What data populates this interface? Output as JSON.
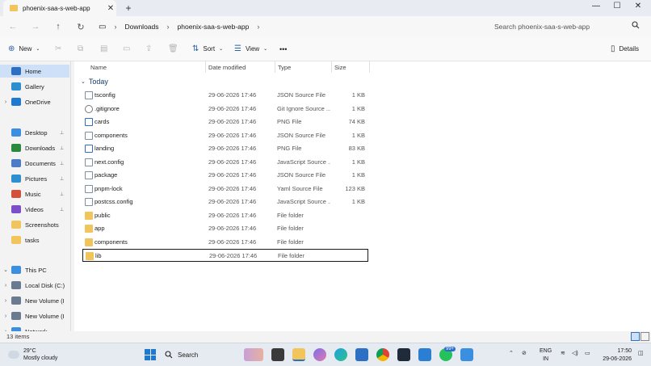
{
  "window": {
    "tab_title": "phoenix-saa-s-web-app",
    "tab_close": "✕",
    "new_tab": "+",
    "minimize": "—",
    "maximize": "☐",
    "close": "✕"
  },
  "address": {
    "back": "←",
    "forward": "→",
    "up": "↑",
    "refresh": "↻",
    "monitor_icon": "▭",
    "crumbs": [
      "Downloads",
      "phoenix-saa-s-web-app"
    ],
    "separator": "›",
    "search_placeholder": "Search phoenix-saa-s-web-app"
  },
  "toolbar": {
    "new_label": "New",
    "sort_label": "Sort",
    "view_label": "View",
    "more_label": "•••",
    "details_label": "Details"
  },
  "sidebar": {
    "items": [
      {
        "label": "Home",
        "selected": true,
        "icon": "home-icon",
        "color": "#2d6fc2"
      },
      {
        "label": "Gallery",
        "icon": "gallery-icon",
        "color": "#2d8fd0"
      },
      {
        "label": "OneDrive",
        "icon": "cloud-icon",
        "color": "#1f79d1",
        "chevron": "›"
      },
      {
        "label": "Desktop",
        "icon": "desktop-icon",
        "color": "#3a8fe0",
        "pin": "📌"
      },
      {
        "label": "Downloads",
        "icon": "download-icon",
        "color": "#2b8a3e",
        "pin": "📌"
      },
      {
        "label": "Documents",
        "icon": "document-icon",
        "color": "#4a7cc9",
        "pin": "📌"
      },
      {
        "label": "Pictures",
        "icon": "pictures-icon",
        "color": "#2d8fd0",
        "pin": "📌"
      },
      {
        "label": "Music",
        "icon": "music-icon",
        "color": "#d4503a",
        "pin": "📌"
      },
      {
        "label": "Videos",
        "icon": "videos-icon",
        "color": "#7a4fc9",
        "pin": "📌"
      },
      {
        "label": "Screenshots",
        "icon": "folder-icon",
        "color": "#f2c55c"
      },
      {
        "label": "tasks",
        "icon": "folder-icon",
        "color": "#f2c55c"
      },
      {
        "label": "This PC",
        "icon": "pc-icon",
        "color": "#3a8fe0",
        "chevron": "⌄"
      },
      {
        "label": "Local Disk (C:)",
        "icon": "drive-icon",
        "color": "#6a7a90",
        "chevron": "›"
      },
      {
        "label": "New Volume (I",
        "icon": "drive-icon",
        "color": "#6a7a90",
        "chevron": "›"
      },
      {
        "label": "New Volume (I",
        "icon": "drive-icon",
        "color": "#6a7a90",
        "chevron": "›"
      },
      {
        "label": "Network",
        "icon": "network-icon",
        "color": "#3a8fe0",
        "chevron": "›"
      }
    ]
  },
  "columns": {
    "name": "Name",
    "date": "Date modified",
    "type": "Type",
    "size": "Size"
  },
  "group_label": "Today",
  "files": [
    {
      "name": "tsconfig",
      "date": "29-06-2026 17:46",
      "type": "JSON Source File",
      "size": "1 KB",
      "kind": "file"
    },
    {
      "name": ".gitignore",
      "date": "29-06-2026 17:46",
      "type": "Git Ignore Source ...",
      "size": "1 KB",
      "kind": "gear"
    },
    {
      "name": "cards",
      "date": "29-06-2026 17:46",
      "type": "PNG File",
      "size": "74 KB",
      "kind": "img"
    },
    {
      "name": "components",
      "date": "29-06-2026 17:46",
      "type": "JSON Source File",
      "size": "1 KB",
      "kind": "file"
    },
    {
      "name": "landing",
      "date": "29-06-2026 17:46",
      "type": "PNG File",
      "size": "83 KB",
      "kind": "img"
    },
    {
      "name": "next.config",
      "date": "29-06-2026 17:46",
      "type": "JavaScript Source ...",
      "size": "1 KB",
      "kind": "file"
    },
    {
      "name": "package",
      "date": "29-06-2026 17:46",
      "type": "JSON Source File",
      "size": "1 KB",
      "kind": "file"
    },
    {
      "name": "pnpm-lock",
      "date": "29-06-2026 17:46",
      "type": "Yaml Source File",
      "size": "123 KB",
      "kind": "file"
    },
    {
      "name": "postcss.config",
      "date": "29-06-2026 17:46",
      "type": "JavaScript Source ...",
      "size": "1 KB",
      "kind": "file"
    },
    {
      "name": "public",
      "date": "29-06-2026 17:46",
      "type": "File folder",
      "size": "",
      "kind": "folder"
    },
    {
      "name": "app",
      "date": "29-06-2026 17:46",
      "type": "File folder",
      "size": "",
      "kind": "folder"
    },
    {
      "name": "components",
      "date": "29-06-2026 17:46",
      "type": "File folder",
      "size": "",
      "kind": "folder"
    },
    {
      "name": "lib",
      "date": "29-06-2026 17:46",
      "type": "File folder",
      "size": "",
      "kind": "folder",
      "selected": true
    }
  ],
  "status": {
    "item_count": "13 items"
  },
  "taskbar": {
    "temperature": "29°C",
    "condition": "Mostly cloudy",
    "search_label": "Search",
    "badge": "99+",
    "lang_line1": "ENG",
    "lang_line2": "IN",
    "time": "17:50",
    "date": "29-06-2026"
  }
}
